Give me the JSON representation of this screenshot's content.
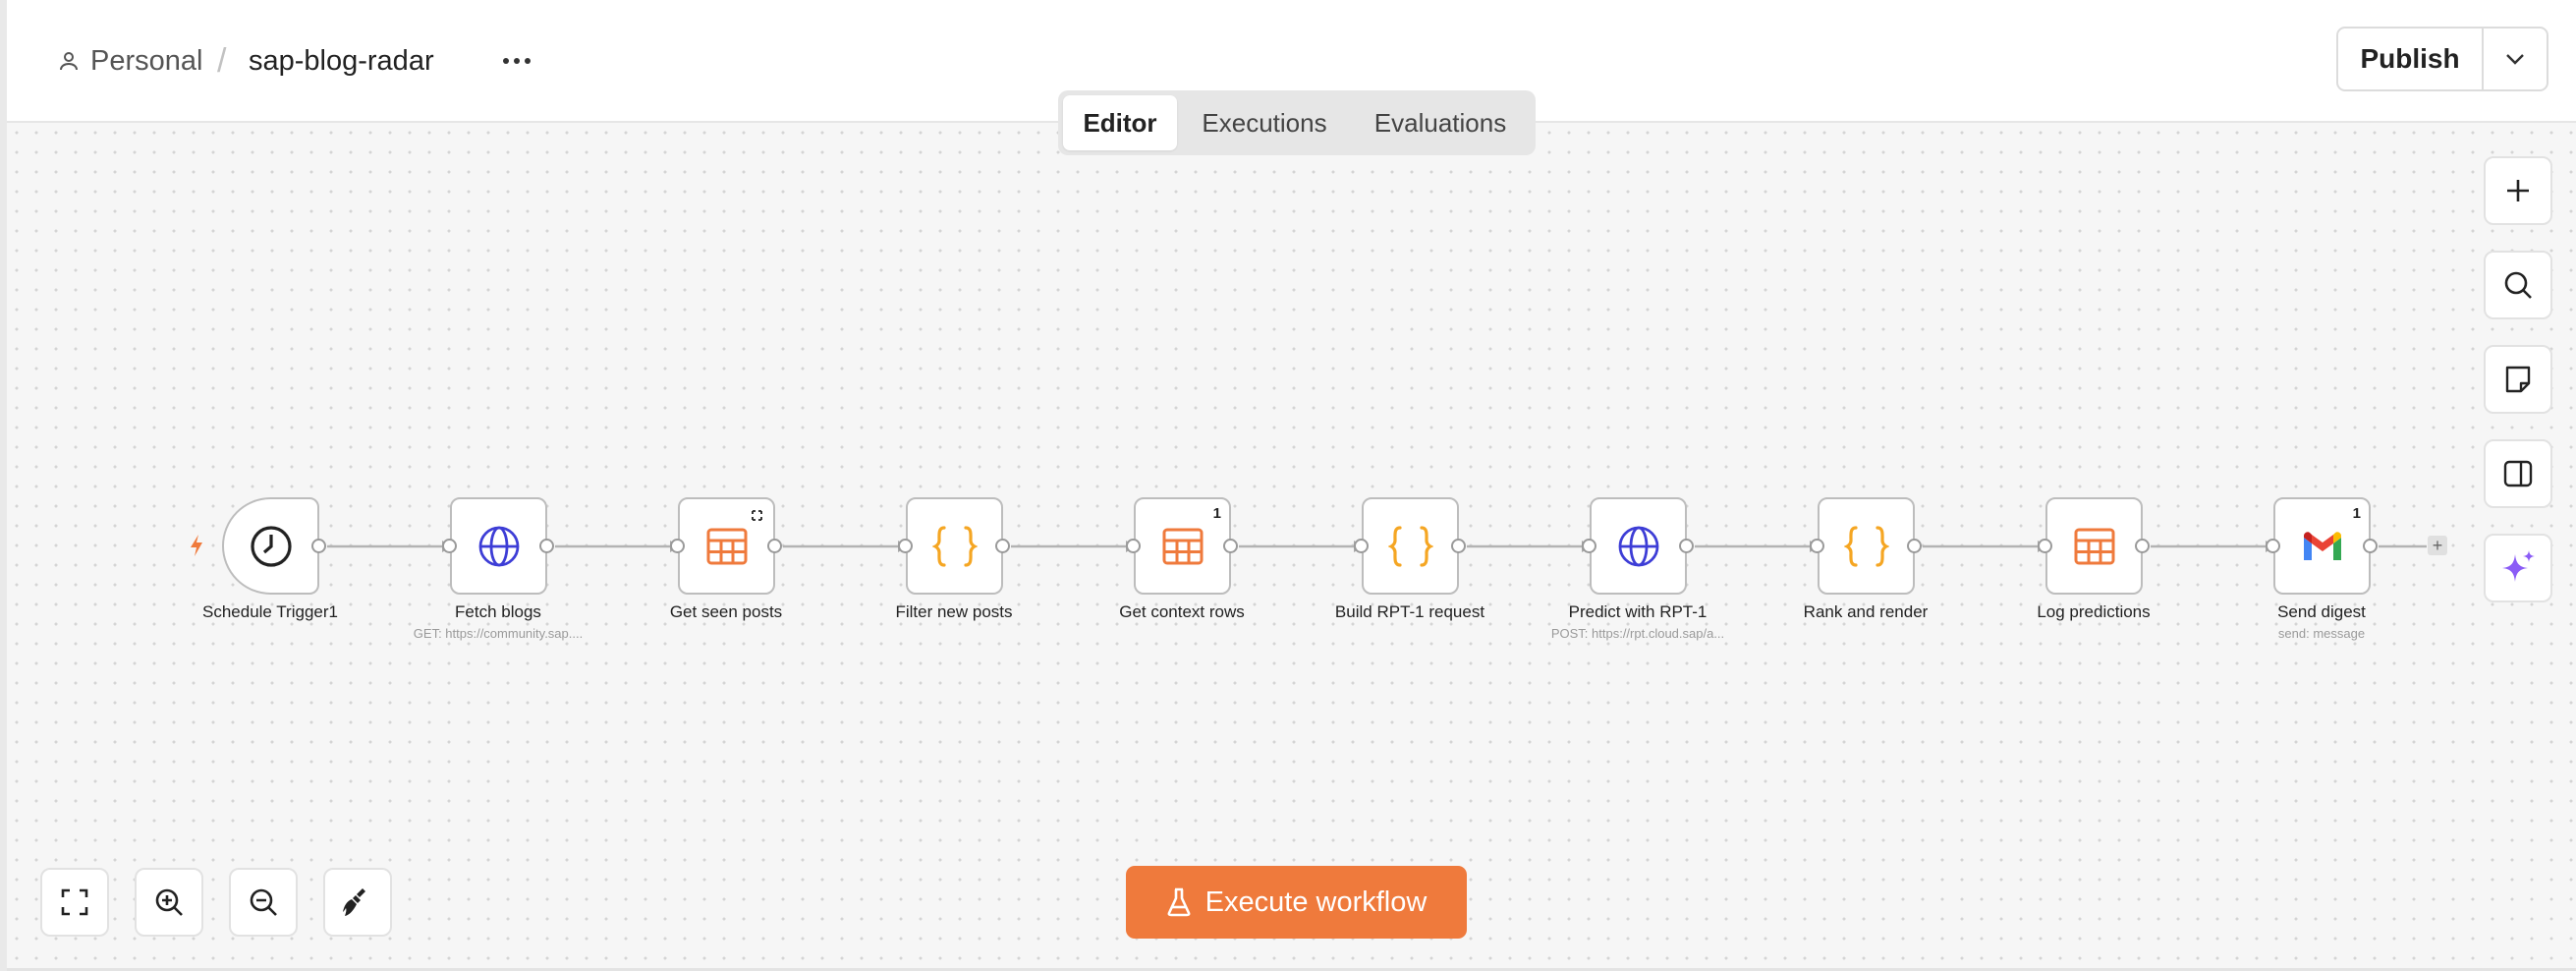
{
  "header": {
    "breadcrumb_personal": "Personal",
    "breadcrumb_separator": "/",
    "workflow_name": "sap-blog-radar",
    "publish_label": "Publish"
  },
  "tabs": [
    {
      "label": "Editor",
      "active": true
    },
    {
      "label": "Executions",
      "active": false
    },
    {
      "label": "Evaluations",
      "active": false
    }
  ],
  "execute_label": "Execute workflow",
  "nodes": [
    {
      "label": "Schedule Trigger1",
      "subtitle": "",
      "icon": "clock-icon",
      "badge": ""
    },
    {
      "label": "Fetch blogs",
      "subtitle": "GET: https://community.sap....",
      "icon": "globe-icon",
      "badge": ""
    },
    {
      "label": "Get seen posts",
      "subtitle": "",
      "icon": "table-icon",
      "badge": "refresh-icon"
    },
    {
      "label": "Filter new posts",
      "subtitle": "",
      "icon": "code-braces-icon",
      "badge": ""
    },
    {
      "label": "Get context rows",
      "subtitle": "",
      "icon": "table-icon",
      "badge": "1"
    },
    {
      "label": "Build RPT-1 request",
      "subtitle": "",
      "icon": "code-braces-icon",
      "badge": ""
    },
    {
      "label": "Predict with RPT-1",
      "subtitle": "POST: https://rpt.cloud.sap/a...",
      "icon": "globe-icon",
      "badge": ""
    },
    {
      "label": "Rank and render",
      "subtitle": "",
      "icon": "code-braces-icon",
      "badge": ""
    },
    {
      "label": "Log predictions",
      "subtitle": "",
      "icon": "table-icon",
      "badge": ""
    },
    {
      "label": "Send digest",
      "subtitle": "send: message",
      "icon": "gmail-icon",
      "badge": "1"
    }
  ],
  "colors": {
    "accent": "#ef7a3c",
    "table_icon": "#ef7a3c",
    "code_icon": "#f5a623",
    "globe_icon": "#3d3dd6",
    "ai_icon": "#8b5cf6"
  }
}
